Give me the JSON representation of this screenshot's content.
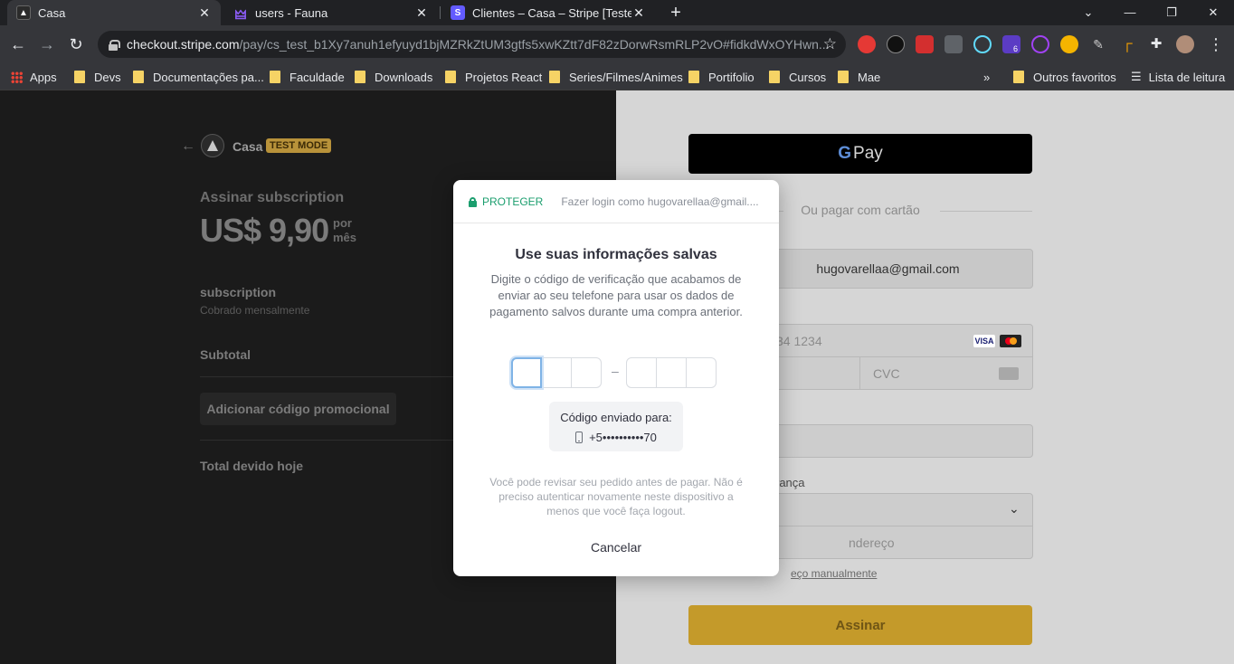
{
  "browser": {
    "tabs": [
      {
        "title": "Casa",
        "close": "✕"
      },
      {
        "title": "users - Fauna",
        "close": "✕"
      },
      {
        "title": "Clientes – Casa – Stripe [Teste]",
        "close": "✕"
      }
    ],
    "new_tab": "+",
    "url_host": "checkout.stripe.com",
    "url_path": "/pay/cs_test_b1Xy7anuh1efyuyd1bjMZRkZtUM3gtfs5xwKZtt7dF82zDorwRsmRLP2vO#fidkdWxOYHwn...",
    "extension_badge": "6",
    "bookmarks": [
      "Apps",
      "Devs",
      "Documentações pa...",
      "Faculdade",
      "Downloads",
      "Projetos React",
      "Series/Filmes/Animes",
      "Portifolio",
      "Cursos",
      "Mae"
    ],
    "bookmarks_more": "»",
    "other_bookmarks": "Outros favoritos",
    "reading_list": "Lista de leitura"
  },
  "summary": {
    "merchant": "Casa",
    "test_mode": "TEST MODE",
    "subscribe_title": "Assinar subscription",
    "price": "US$ 9,90",
    "period": "por mês",
    "item_name": "subscription",
    "item_desc": "Cobrado mensalmente",
    "subtotal_label": "Subtotal",
    "promo_label": "Adicionar código promocional",
    "total_label": "Total devido hoje"
  },
  "payment": {
    "gpay_label": "Pay",
    "or_card": "Ou pagar com cartão",
    "email": "hugovarellaa@gmail.com",
    "card_placeholder": "34 1234",
    "cvc_placeholder": "CVC",
    "card_brands": [
      "VISA"
    ],
    "billing_label": "rança",
    "address_placeholder": "ndereço",
    "manual_link": "eço manualmente",
    "pay_button": "Assinar"
  },
  "modal": {
    "protect": "PROTEGER",
    "login_as": "Fazer login como hugovarellaa@gmail....",
    "title": "Use suas informações salvas",
    "description": "Digite o código de verificação que acabamos de enviar ao seu telefone para usar os dados de pagamento salvos durante uma compra anterior.",
    "code_separator": "–",
    "sent_to_label": "Código enviado para:",
    "phone": "+5••••••••••70",
    "note": "Você pode revisar seu pedido antes de pagar. Não é preciso autenticar novamente neste dispositivo a menos que você faça logout.",
    "cancel": "Cancelar"
  },
  "colors": {
    "protect_green": "#1b9e6e",
    "pay_button": "#c49a2a",
    "test_badge": "#b8923a"
  }
}
